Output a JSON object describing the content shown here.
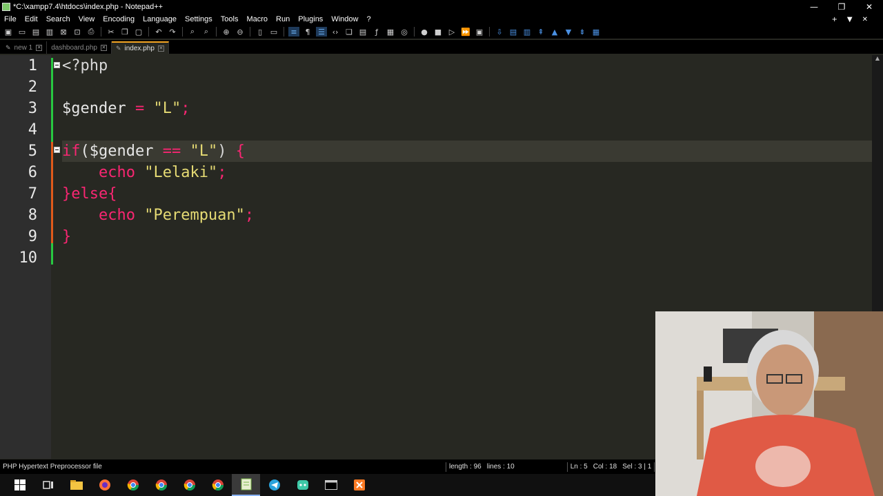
{
  "window": {
    "title": "*C:\\xampp7.4\\htdocs\\index.php - Notepad++",
    "controls": [
      "—",
      "❐",
      "✕"
    ]
  },
  "menu": {
    "items": [
      "File",
      "Edit",
      "Search",
      "View",
      "Encoding",
      "Language",
      "Settings",
      "Tools",
      "Macro",
      "Run",
      "Plugins",
      "Window",
      "?"
    ],
    "right_icons": [
      "+",
      "▼",
      "✕"
    ]
  },
  "tabs": [
    {
      "label": "new 1",
      "active": false
    },
    {
      "label": "dashboard.php",
      "active": false
    },
    {
      "label": "index.php",
      "active": true
    }
  ],
  "editor": {
    "line_numbers": [
      "1",
      "2",
      "3",
      "4",
      "5",
      "6",
      "7",
      "8",
      "9",
      "10"
    ],
    "current_line": 5,
    "lines": [
      [
        {
          "t": "<?php",
          "c": "plain"
        }
      ],
      [],
      [
        {
          "t": "$gender",
          "c": "var"
        },
        {
          "t": " = ",
          "c": "op"
        },
        {
          "t": "\"L\"",
          "c": "str"
        },
        {
          "t": ";",
          "c": "op"
        }
      ],
      [],
      [
        {
          "t": "if",
          "c": "kw"
        },
        {
          "t": "($gender ",
          "c": "var"
        },
        {
          "t": "==",
          "c": "op"
        },
        {
          "t": " \"L\"",
          "c": "str"
        },
        {
          "t": ")",
          "c": "plain"
        },
        {
          "t": " {",
          "c": "op"
        }
      ],
      [
        {
          "t": "    echo ",
          "c": "kw"
        },
        {
          "t": "\"Lelaki\"",
          "c": "str"
        },
        {
          "t": ";",
          "c": "op"
        }
      ],
      [
        {
          "t": "}else{",
          "c": "kw"
        }
      ],
      [
        {
          "t": "    echo ",
          "c": "kw"
        },
        {
          "t": "\"Perempuan\"",
          "c": "str"
        },
        {
          "t": ";",
          "c": "op"
        }
      ],
      [
        {
          "t": "}",
          "c": "kw"
        }
      ],
      []
    ]
  },
  "status": {
    "file_type": "PHP Hypertext Preprocessor file",
    "length": "length : 96",
    "lines": "lines : 10",
    "ln": "Ln : 5",
    "col": "Col : 18",
    "sel": "Sel : 3 | 1"
  },
  "taskbar": {
    "apps": [
      "windows-start",
      "task-view",
      "file-explorer",
      "firefox",
      "chrome",
      "chrome",
      "chrome",
      "chrome",
      "notepad-plus-plus",
      "telegram",
      "discord",
      "terminal",
      "xampp"
    ],
    "active_index": 8
  },
  "colors": {
    "background": "#272822",
    "keyword": "#f92672",
    "string": "#e6db74",
    "accent": "#28c840"
  }
}
